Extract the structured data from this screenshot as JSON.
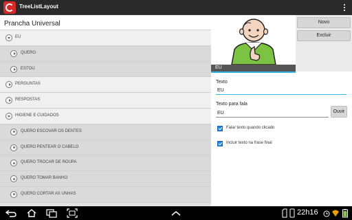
{
  "app": {
    "title": "TreeListLayout"
  },
  "list": {
    "header": "Prancha Universal",
    "items": [
      {
        "label": "EU",
        "level": 0,
        "state": "expanded"
      },
      {
        "label": "QUERO",
        "level": 1,
        "state": "collapsed"
      },
      {
        "label": "ESTOU",
        "level": 1,
        "state": "collapsed"
      },
      {
        "label": "PERGUNTAS",
        "level": 0,
        "state": "collapsed"
      },
      {
        "label": "RESPOSTAS",
        "level": 0,
        "state": "collapsed"
      },
      {
        "label": "HIGIENE E CUIDADOS",
        "level": 0,
        "state": "expanded"
      },
      {
        "label": "QUERO ESCOVAR OS DENTES",
        "level": 1,
        "state": "leaf"
      },
      {
        "label": "QUERO PENTEAR O CABELO",
        "level": 1,
        "state": "leaf"
      },
      {
        "label": "QUERO TROCAR DE ROUPA",
        "level": 1,
        "state": "leaf"
      },
      {
        "label": "QUERO TOMAR BANHO",
        "level": 1,
        "state": "leaf"
      },
      {
        "label": "QUERO CORTAR AS UNHAS",
        "level": 1,
        "state": "leaf"
      }
    ]
  },
  "detail": {
    "image_caption": "EU",
    "buttons": {
      "new": "Novo",
      "delete": "Excluir",
      "listen": "Ouvir"
    },
    "text_field": {
      "label": "Texto",
      "value": "EU"
    },
    "speech_field": {
      "label": "Texto para fala",
      "value": "EU"
    },
    "checkboxes": [
      {
        "label": "Falar texto quando clicado",
        "checked": true
      },
      {
        "label": "Incluir texto na frase final",
        "checked": true
      }
    ]
  },
  "system_bar": {
    "time": "22h16"
  },
  "colors": {
    "accent": "#33b5e5",
    "action_bar": "#2a2a2a",
    "checkbox": "#1e88e5"
  }
}
